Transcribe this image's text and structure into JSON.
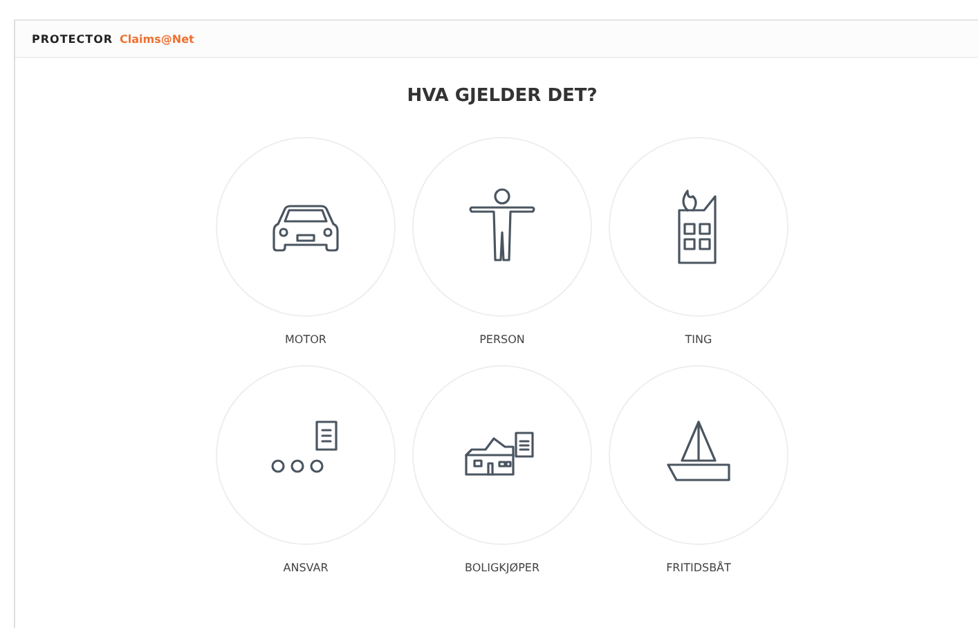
{
  "header": {
    "brand": "PROTECTOR",
    "product": "Claims@Net"
  },
  "heading": "HVA GJELDER DET?",
  "options": [
    {
      "label": "MOTOR",
      "kind": "car"
    },
    {
      "label": "PERSON",
      "kind": "person"
    },
    {
      "label": "TING",
      "kind": "building"
    },
    {
      "label": "ANSVAR",
      "kind": "liability"
    },
    {
      "label": "BOLIGKJØPER",
      "kind": "house"
    },
    {
      "label": "FRITIDSBÅT",
      "kind": "boat"
    }
  ]
}
